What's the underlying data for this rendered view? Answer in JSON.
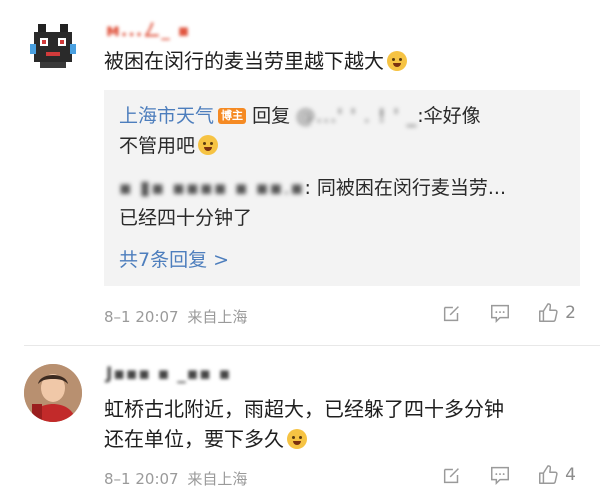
{
  "comments": [
    {
      "username": "ᴍ...ㄥ_ ▪",
      "text": "被困在闵行的麦当劳里越下越大",
      "emoji": "crying-face",
      "replies": {
        "reply1_author": "上海市天气",
        "reply1_badge": "博主",
        "reply1_prefix": "回复 ",
        "reply1_target": "@...' ' . ! ' _",
        "reply1_text": ":伞好像",
        "reply1_text2": "不管用吧",
        "reply1_emoji": "laughing-tears",
        "reply2_author": "▪ ▮▪  ▪▪▪▪ ▪ ▪▪.▪",
        "reply2_text": ": 同被困在闵行麦当劳...",
        "reply2_text2": "已经四十分钟了",
        "more_label": "共7条回复 >"
      },
      "timestamp": "8–1 20:07",
      "source": "来自上海",
      "like_count": "2"
    },
    {
      "username": "J▪▪▪ ▪ _▪▪ ▪",
      "text_line1": "虹桥古北附近，雨超大，已经躲了四十多分钟",
      "text_line2": "还在单位，要下多久",
      "emoji": "fearful-face",
      "timestamp": "8–1 20:07",
      "source": "来自上海",
      "like_count": "4"
    }
  ],
  "colors": {
    "link_blue": "#4d7ebd",
    "badge_orange": "#f58a23",
    "meta_gray": "#9a9a9a",
    "reply_bg": "#f3f3f3"
  }
}
